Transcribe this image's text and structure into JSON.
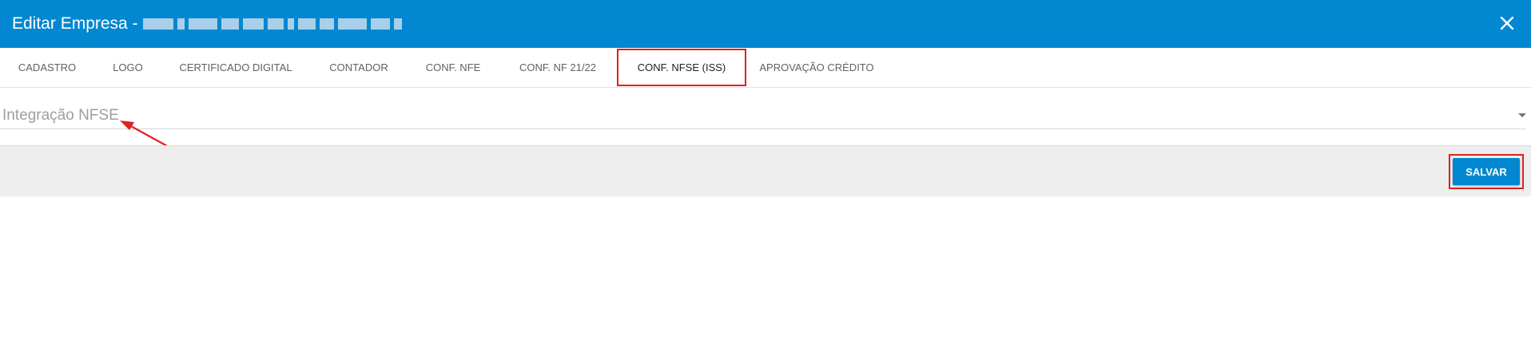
{
  "dialog": {
    "title": "Editar Empresa -",
    "close_icon": "close-icon"
  },
  "tabs": [
    {
      "label": "CADASTRO"
    },
    {
      "label": "LOGO"
    },
    {
      "label": "CERTIFICADO DIGITAL"
    },
    {
      "label": "CONTADOR"
    },
    {
      "label": "CONF. NFE"
    },
    {
      "label": "CONF. NF 21/22"
    },
    {
      "label": "CONF. NFSE (ISS)",
      "active": true
    },
    {
      "label": "APROVAÇÃO CRÉDITO"
    }
  ],
  "form": {
    "integracao_label": "Integração NFSE"
  },
  "footer": {
    "save_label": "SALVAR"
  },
  "colors": {
    "primary": "#0288d1",
    "highlight": "#e02020"
  }
}
